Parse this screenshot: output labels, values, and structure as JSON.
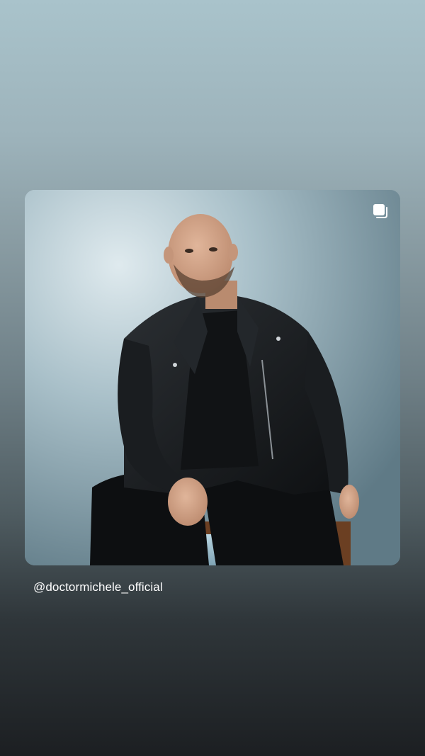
{
  "post": {
    "username": "@doctormichele_official",
    "media_icon": "multiple-posts-icon",
    "photo_subject": "man in black leather jacket seated on chair"
  },
  "colors": {
    "background_top": "#a9c3cb",
    "background_bottom": "#1c1f22",
    "text": "#ffffff"
  }
}
